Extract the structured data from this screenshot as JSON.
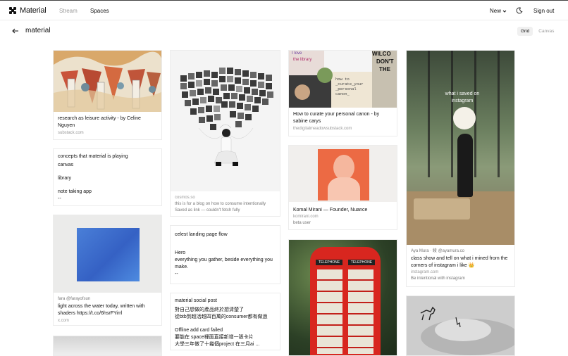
{
  "app": {
    "name": "Material"
  },
  "nav": {
    "stream": "Stream",
    "spaces": "Spaces"
  },
  "header": {
    "new_label": "New",
    "sign_out": "Sign out"
  },
  "space": {
    "title": "material"
  },
  "view": {
    "grid": "Grid",
    "canvas": "Canvas"
  },
  "cards": {
    "research": {
      "title": "research as leisure activity - by Celine Nguyen",
      "source": "substack.com"
    },
    "concepts": {
      "title": "concepts that material is playing",
      "lines": [
        "canvas",
        "library",
        "note taking app",
        "--"
      ]
    },
    "blue": {
      "author": "fara @farayofsun",
      "title": "light across the water today, written with shaders https://t.co/6hsrFYirrl",
      "source": "x.com"
    },
    "collage": {
      "source": "cosmos.so",
      "note": "this is for a blog on how to consume intentionally",
      "status": "Saved as link — couldn't fetch fully"
    },
    "celest": {
      "title": "celest landing page flow",
      "lines": [
        "Hero",
        "everything you gather, beside everything you make.",
        "--"
      ]
    },
    "social": {
      "title": "material social post",
      "lines": [
        "對自己想做的產品終於想清楚了",
        "從btb到超活越四百萬的consumer都有做過",
        "Offline add card failed",
        "要能在 space裡面直接新增一張卡片",
        "大學三年做了十幾個project 在三月ai ..."
      ]
    },
    "canon": {
      "title": "How to curate your personal canon - by sabine carys",
      "source": "thedigitalmeadowsubstack.com",
      "img_lines": [
        "I love",
        "the library",
        "WILCO",
        "DON'T",
        "THE",
        "how to",
        "_curate_your",
        "_personal",
        "canon_"
      ]
    },
    "komal": {
      "title": "Komal Mirani — Founder, Nuance",
      "source": "komirani.com",
      "note": "beta user"
    },
    "booth": {
      "sign": "TELEPHONE"
    },
    "aya": {
      "author": "Aya Mura · 綾 @ayamura.co",
      "title": "class show and tell on what i mined from the corners of instagram i like 👑",
      "source": "instagram.com",
      "note": "Be intentional with instagram",
      "overlay": "what i saved on instagram"
    }
  }
}
